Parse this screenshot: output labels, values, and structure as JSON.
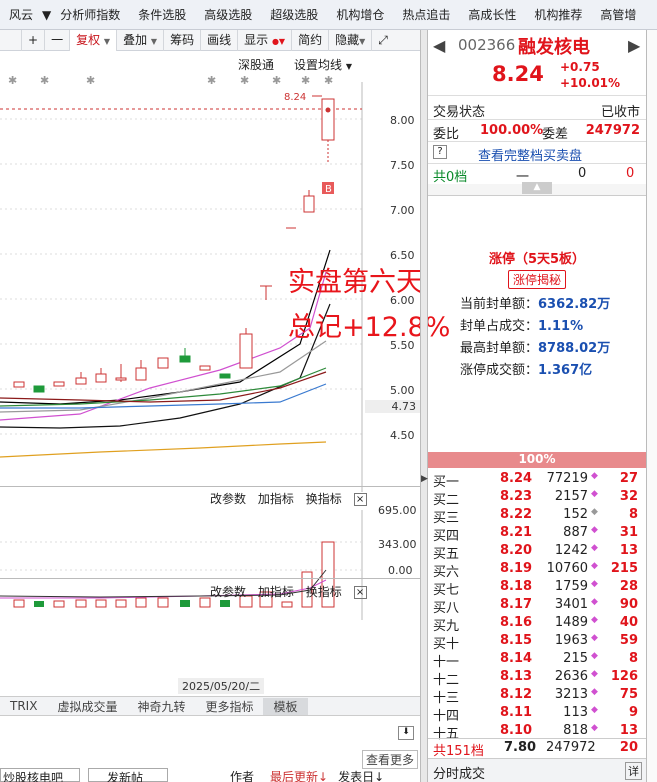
{
  "topnav": {
    "items": [
      "风云",
      "分析师指数",
      "条件选股",
      "高级选股",
      "超级选股",
      "机构增仓",
      "热点追击",
      "高成长性",
      "机构推荐",
      "高管增"
    ]
  },
  "toolbar": {
    "plus": "+",
    "minus": "一",
    "fuquan": "复权",
    "diejia": "叠加",
    "chouma": "筹码",
    "huaxian": "画线",
    "xianshi": "显示",
    "jianyue": "简约",
    "yincang": "隐藏"
  },
  "chart_header": {
    "market": "深股通",
    "setting": "设置均线"
  },
  "main_chart": {
    "y_labels": [
      "8.00",
      "7.50",
      "7.00",
      "6.50",
      "6.00",
      "5.50",
      "5.00",
      "4.73",
      "4.50"
    ],
    "price_tag": "8.24",
    "buy_marker": "B"
  },
  "overlay": {
    "line1": "实盘第六天",
    "line2": "总记+12.8%"
  },
  "volume_panel": {
    "buttons": [
      "改参数",
      "加指标",
      "换指标"
    ],
    "close": "×",
    "y_labels": [
      "695.00",
      "343.00",
      "0.00"
    ]
  },
  "bottom_panel": {
    "buttons": [
      "改参数",
      "加指标",
      "换指标"
    ],
    "close": "×"
  },
  "date_label": "2025/05/20/二",
  "indicator_tabs": [
    "TRIX",
    "虚拟成交量",
    "神奇九转",
    "更多指标",
    "模板"
  ],
  "bottom_left": {
    "items": [
      "炒股核电吧",
      "发新帖",
      "作者",
      "最后更新↓",
      "发表日↓"
    ],
    "more": "查看更多"
  },
  "stock": {
    "code": "002366",
    "name": "融发核电",
    "price": "8.24",
    "change": "+0.75",
    "pct": "+10.01%"
  },
  "status": {
    "label": "交易状态",
    "value": "已收市"
  },
  "weibi": {
    "label": "委比",
    "value": "100.00%",
    "label2": "委差",
    "value2": "247972"
  },
  "full_orderbook_link": "查看完整档买卖盘",
  "sell_total": {
    "label": "共0档",
    "dash": "一",
    "vol": "0",
    "cnt": "0"
  },
  "limit_up": {
    "title": "涨停（5天5板）",
    "button": "涨停揭秘",
    "stats": [
      {
        "label": "当前封单额：",
        "value": "6362.82万"
      },
      {
        "label": "封单占成交：",
        "value": "1.11%"
      },
      {
        "label": "最高封单额：",
        "value": "8788.02万"
      },
      {
        "label": "涨停成交额：",
        "value": "1.367亿"
      }
    ]
  },
  "bid_ratio": "100%",
  "bids": [
    {
      "label": "买一",
      "price": "8.24",
      "vol": "77219",
      "cnt": "27"
    },
    {
      "label": "买二",
      "price": "8.23",
      "vol": "2157",
      "cnt": "32"
    },
    {
      "label": "买三",
      "price": "8.22",
      "vol": "152",
      "cnt": "8"
    },
    {
      "label": "买四",
      "price": "8.21",
      "vol": "887",
      "cnt": "31"
    },
    {
      "label": "买五",
      "price": "8.20",
      "vol": "1242",
      "cnt": "13"
    },
    {
      "label": "买六",
      "price": "8.19",
      "vol": "10760",
      "cnt": "215"
    },
    {
      "label": "买七",
      "price": "8.18",
      "vol": "1759",
      "cnt": "28"
    },
    {
      "label": "买八",
      "price": "8.17",
      "vol": "3401",
      "cnt": "90"
    },
    {
      "label": "买九",
      "price": "8.16",
      "vol": "1489",
      "cnt": "40"
    },
    {
      "label": "买十",
      "price": "8.15",
      "vol": "1963",
      "cnt": "59"
    },
    {
      "label": "十一",
      "price": "8.14",
      "vol": "215",
      "cnt": "8"
    },
    {
      "label": "十二",
      "price": "8.13",
      "vol": "2636",
      "cnt": "126"
    },
    {
      "label": "十三",
      "price": "8.12",
      "vol": "3213",
      "cnt": "75"
    },
    {
      "label": "十四",
      "price": "8.11",
      "vol": "113",
      "cnt": "9"
    },
    {
      "label": "十五",
      "price": "8.10",
      "vol": "818",
      "cnt": "13"
    }
  ],
  "buy_total": {
    "label": "共151档",
    "price": "7.80",
    "vol": "247972",
    "cnt": "20"
  },
  "fenshi": "分时成交",
  "fenshi_icon": "详"
}
